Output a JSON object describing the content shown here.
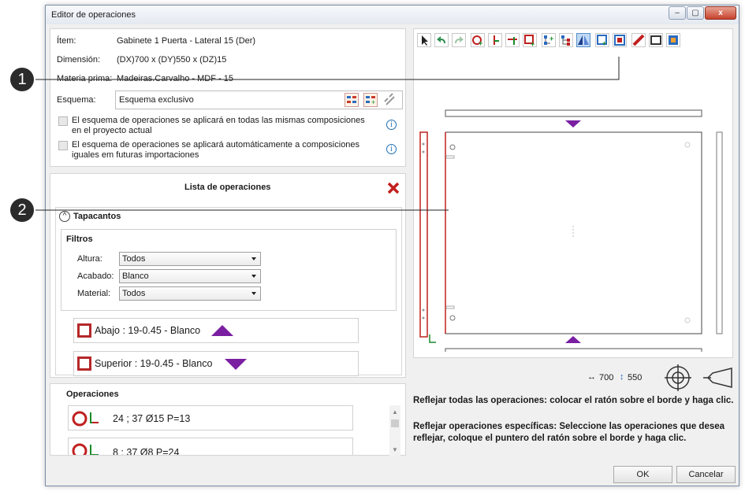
{
  "window": {
    "title": "Editor de operaciones",
    "controls": {
      "minimize": "–",
      "maximize": "▢",
      "close": "x"
    }
  },
  "info": {
    "item_label": "Ítem:",
    "item_value": "Gabinete 1 Puerta - Lateral 15 (Der)",
    "dim_label": "Dimensión:",
    "dim_value": "(DX)700 x (DY)550 x (DZ)15",
    "mat_label": "Materia prima:",
    "mat_value": "Madeiras.Carvalho - MDF - 15"
  },
  "schema": {
    "label": "Esquema:",
    "value": "Esquema exclusivo",
    "checkbox1": "El esquema de operaciones se aplicará en todas las mismas composiciones en el proyecto actual",
    "checkbox2": "El esquema de operaciones se aplicará automáticamente a composiciones iguales em futuras importaciones",
    "info_glyph": "i"
  },
  "callouts": {
    "one": "1",
    "two": "2"
  },
  "operations_list": {
    "title": "Lista de operaciones",
    "section": "Tapacantos",
    "filters_title": "Filtros",
    "filters": [
      {
        "label": "Altura:",
        "value": "Todos"
      },
      {
        "label": "Acabado:",
        "value": "Blanco"
      },
      {
        "label": "Material:",
        "value": "Todos"
      }
    ],
    "edges": [
      {
        "text": "Abajo : 19-0.45 - Blanco"
      },
      {
        "text": "Superior : 19-0.45 - Blanco"
      }
    ]
  },
  "operaciones": {
    "title": "Operaciones",
    "items": [
      {
        "text": "24 ; 37 Ø15 P=13"
      },
      {
        "text": "8 ; 37 Ø8 P=24"
      }
    ]
  },
  "dims": {
    "dx": "700",
    "dy": "550"
  },
  "help": {
    "line1": "Reflejar todas las operaciones: colocar el ratón sobre el borde y haga clic.",
    "line2": "Reflejar operaciones específicas: Seleccione las operaciones que desea reflejar, coloque el puntero del ratón sobre el borde y haga clic."
  },
  "buttons": {
    "ok": "OK",
    "cancel": "Cancelar"
  },
  "colors": {
    "accent_purple": "#7a1fa2",
    "edge_red": "#b5282a",
    "delete_red": "#c0201f"
  },
  "toolbar_icons": [
    "cursor-icon",
    "undo-icon",
    "redo-icon",
    "circle-add-icon",
    "add-line-icon",
    "add-line-red-icon",
    "square-add-icon",
    "tree-add-icon",
    "tree-icon",
    "mirror-icon",
    "panel-add-icon",
    "panel-icon",
    "ruler-icon",
    "frame-icon",
    "export-icon"
  ]
}
